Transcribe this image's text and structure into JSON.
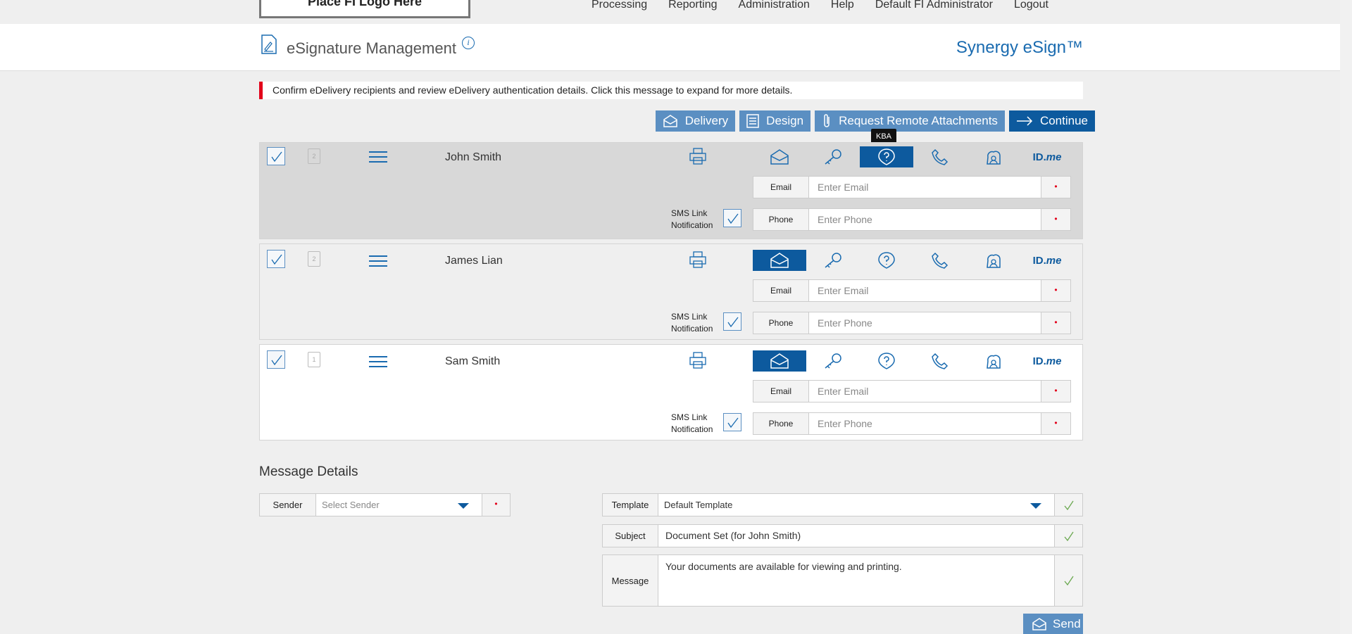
{
  "nav": {
    "logo": "Place FI Logo Here",
    "items": [
      "Processing",
      "Reporting",
      "Administration",
      "Help",
      "Default FI Administrator",
      "Logout"
    ]
  },
  "header": {
    "title": "eSignature Management",
    "info": "i",
    "brand": "Synergy eSign™"
  },
  "alert": "Confirm eDelivery recipients and review eDelivery authentication details. Click this message to expand for more details.",
  "toolbar": {
    "delivery": "Delivery",
    "design": "Design",
    "attachments": "Request Remote Attachments",
    "continue": "Continue"
  },
  "tooltip": "KBA",
  "recipients": [
    {
      "name": "John Smith",
      "doc_count": "2",
      "email_label": "Email",
      "email_placeholder": "Enter Email",
      "phone_label": "Phone",
      "phone_placeholder": "Enter Phone",
      "sms_line1": "SMS Link",
      "sms_line2": "Notification",
      "required": "•",
      "selected_method": "kba"
    },
    {
      "name": "James Lian",
      "doc_count": "2",
      "email_label": "Email",
      "email_placeholder": "Enter Email",
      "phone_label": "Phone",
      "phone_placeholder": "Enter Phone",
      "sms_line1": "SMS Link",
      "sms_line2": "Notification",
      "required": "•",
      "selected_method": "email"
    },
    {
      "name": "Sam Smith",
      "doc_count": "1",
      "email_label": "Email",
      "email_placeholder": "Enter Email",
      "phone_label": "Phone",
      "phone_placeholder": "Enter Phone",
      "sms_line1": "SMS Link",
      "sms_line2": "Notification",
      "required": "•",
      "selected_method": "email"
    }
  ],
  "idme": {
    "id": "ID.",
    "me": "me"
  },
  "message_details": {
    "title": "Message Details",
    "sender_label": "Sender",
    "sender_placeholder": "Select Sender",
    "required": "•",
    "template_label": "Template",
    "template_value": "Default Template",
    "subject_label": "Subject",
    "subject_value": "Document Set (for John Smith)",
    "message_label": "Message",
    "message_value": "Your documents are available for viewing and printing.",
    "send": "Send"
  },
  "colors": {
    "accent": "#0d5a9e",
    "button": "#5b8fc2",
    "alert": "#e2001a",
    "ok": "#6aa84f"
  }
}
